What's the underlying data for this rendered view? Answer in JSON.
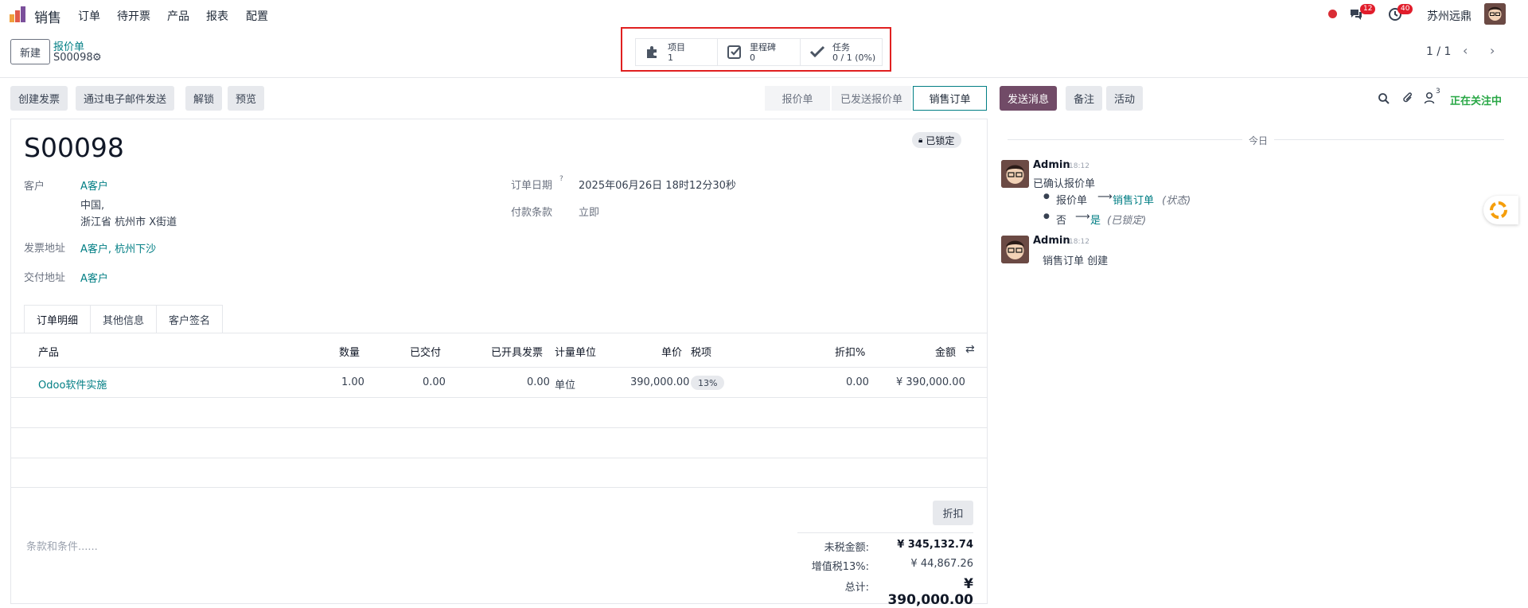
{
  "app": {
    "name": "销售",
    "menu": [
      "订单",
      "待开票",
      "产品",
      "报表",
      "配置"
    ],
    "messages_count": "12",
    "activities_count": "40",
    "company": "苏州远鼎"
  },
  "control": {
    "new_label": "新建",
    "breadcrumb_parent": "报价单",
    "record_name": "S00098",
    "pager": "1 / 1"
  },
  "smart_buttons": [
    {
      "label": "项目",
      "value": "1",
      "icon": "puzzle-icon"
    },
    {
      "label": "里程碑",
      "value": "0",
      "icon": "check-square-icon"
    },
    {
      "label": "任务",
      "value": "0 / 1 (0%)",
      "icon": "check-icon"
    }
  ],
  "actions": [
    "创建发票",
    "通过电子邮件发送",
    "解锁",
    "预览"
  ],
  "stages": [
    "报价单",
    "已发送报价单",
    "销售订单"
  ],
  "form": {
    "title": "S00098",
    "locked_label": "已锁定",
    "customer_label": "客户",
    "customer_name": "A客户",
    "customer_addr1": "中国,",
    "customer_addr2": "浙江省 杭州市 X街道",
    "invoice_addr_label": "发票地址",
    "invoice_addr": "A客户, 杭州下沙",
    "delivery_addr_label": "交付地址",
    "delivery_addr": "A客户",
    "order_date_label": "订单日期",
    "order_date_help": "?",
    "order_date": "2025年06月26日 18时12分30秒",
    "payment_terms_label": "付款条款",
    "payment_terms": "立即"
  },
  "tabs": [
    "订单明细",
    "其他信息",
    "客户签名"
  ],
  "table": {
    "headers": [
      "产品",
      "数量",
      "已交付",
      "已开具发票",
      "计量单位",
      "单价",
      "税项",
      "折扣%",
      "金额"
    ],
    "rows": [
      {
        "product": "Odoo软件实施",
        "qty": "1.00",
        "delivered": "0.00",
        "invoiced": "0.00",
        "uom": "单位",
        "price": "390,000.00",
        "tax": "13%",
        "discount": "0.00",
        "amount": "¥ 390,000.00"
      }
    ]
  },
  "fold_label": "折扣",
  "terms_placeholder": "条款和条件......",
  "totals": {
    "untaxed_label": "未税金额:",
    "untaxed": "¥ 345,132.74",
    "tax_label": "增值税13%:",
    "tax": "¥ 44,867.26",
    "total_label": "总计:",
    "total": "¥ 390,000.00"
  },
  "chatter": {
    "send_label": "发送消息",
    "note_label": "备注",
    "activity_label": "活动",
    "followers_count": "3",
    "following_label": "正在关注中",
    "today_label": "今日",
    "messages": [
      {
        "author": "Admin",
        "time": "18:12",
        "text": "已确认报价单",
        "changes": [
          {
            "old": "报价单",
            "new": "销售订单",
            "field": "(状态)"
          },
          {
            "old": "否",
            "new": "是",
            "field": "(已锁定)"
          }
        ]
      },
      {
        "author": "Admin",
        "time": "18:12",
        "text": "销售订单 创建"
      }
    ]
  },
  "colors": {
    "primary": "#714b67",
    "link": "#017e84",
    "highlight_box": "#e02020"
  }
}
